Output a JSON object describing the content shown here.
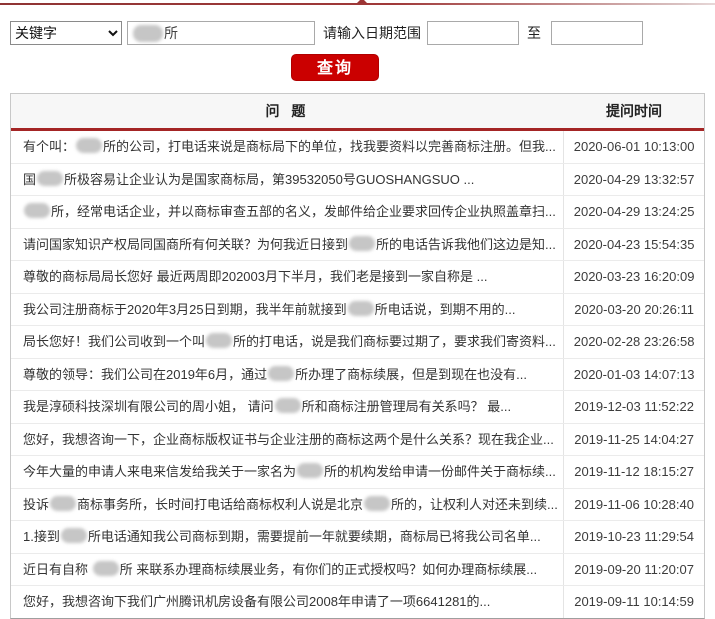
{
  "colors": {
    "accent_red": "#cb0000",
    "header_rule_red": "#a42525",
    "top_line_red": "#9c3535"
  },
  "search_form": {
    "field_type_select": {
      "value": "关键字"
    },
    "keyword_input": {
      "visible_text": "所",
      "censored_prefix": "██"
    },
    "date_range_label": "请输入日期范围",
    "date_from_value": "",
    "date_to_value": "",
    "to_label": "至",
    "search_button": "查询"
  },
  "table": {
    "headers": {
      "question": "问 题",
      "time": "提问时间"
    },
    "rows": [
      {
        "segments": [
          {
            "censored": false,
            "text": "有个叫："
          },
          {
            "censored": true,
            "text": "██"
          },
          {
            "censored": false,
            "text": "所的公司，打电话来说是商标局下的单位，找我要资料以完善商标注册。但我..."
          }
        ],
        "time": "2020-06-01 10:13:00"
      },
      {
        "segments": [
          {
            "censored": false,
            "text": "国"
          },
          {
            "censored": true,
            "text": "██"
          },
          {
            "censored": false,
            "text": "所极容易让企业认为是国家商标局，第39532050号GUOSHANGSUO ..."
          }
        ],
        "time": "2020-04-29 13:32:57"
      },
      {
        "segments": [
          {
            "censored": true,
            "text": "██"
          },
          {
            "censored": false,
            "text": "所，经常电话企业，并以商标审查五部的名义，发邮件给企业要求回传企业执照盖章扫..."
          }
        ],
        "time": "2020-04-29 13:24:25"
      },
      {
        "segments": [
          {
            "censored": false,
            "text": "请问国家知识产权局同国商所有何关联？为何我近日接到"
          },
          {
            "censored": true,
            "text": "██"
          },
          {
            "censored": false,
            "text": "所的电话告诉我他们这边是知..."
          }
        ],
        "time": "2020-04-23 15:54:35"
      },
      {
        "segments": [
          {
            "censored": false,
            "text": "尊敬的商标局局长您好 最近两周即202003月下半月，我们老是接到一家自称是 ..."
          }
        ],
        "time": "2020-03-23 16:20:09"
      },
      {
        "segments": [
          {
            "censored": false,
            "text": "我公司注册商标于2020年3月25日到期，我半年前就接到"
          },
          {
            "censored": true,
            "text": "██"
          },
          {
            "censored": false,
            "text": "所电话说，到期不用的..."
          }
        ],
        "time": "2020-03-20 20:26:11"
      },
      {
        "segments": [
          {
            "censored": false,
            "text": "局长您好！我们公司收到一个叫"
          },
          {
            "censored": true,
            "text": "██"
          },
          {
            "censored": false,
            "text": "所的打电话，说是我们商标要过期了，要求我们寄资料..."
          }
        ],
        "time": "2020-02-28 23:26:58"
      },
      {
        "segments": [
          {
            "censored": false,
            "text": "尊敬的领导：我们公司在2019年6月，通过"
          },
          {
            "censored": true,
            "text": "██"
          },
          {
            "censored": false,
            "text": "所办理了商标续展，但是到现在也没有..."
          }
        ],
        "time": "2020-01-03 14:07:13"
      },
      {
        "segments": [
          {
            "censored": false,
            "text": "我是淳硕科技深圳有限公司的周小姐， 请问"
          },
          {
            "censored": true,
            "text": "██"
          },
          {
            "censored": false,
            "text": "所和商标注册管理局有关系吗？ 最..."
          }
        ],
        "time": "2019-12-03 11:52:22"
      },
      {
        "segments": [
          {
            "censored": false,
            "text": "您好，我想咨询一下，企业商标版权证书与企业注册的商标这两个是什么关系？现在我企业..."
          }
        ],
        "time": "2019-11-25 14:04:27"
      },
      {
        "segments": [
          {
            "censored": false,
            "text": "今年大量的申请人来电来信发给我关于一家名为"
          },
          {
            "censored": true,
            "text": "██"
          },
          {
            "censored": false,
            "text": "所的机构发给申请一份邮件关于商标续..."
          }
        ],
        "time": "2019-11-12 18:15:27"
      },
      {
        "segments": [
          {
            "censored": false,
            "text": "投诉"
          },
          {
            "censored": true,
            "text": "██"
          },
          {
            "censored": false,
            "text": "商标事务所，长时间打电话给商标权利人说是北京"
          },
          {
            "censored": true,
            "text": "██"
          },
          {
            "censored": false,
            "text": "所的，让权利人对还未到续..."
          }
        ],
        "time": "2019-11-06 10:28:40"
      },
      {
        "segments": [
          {
            "censored": false,
            "text": "1.接到"
          },
          {
            "censored": true,
            "text": "██"
          },
          {
            "censored": false,
            "text": "所电话通知我公司商标到期，需要提前一年就要续期，商标局已将我公司名单..."
          }
        ],
        "time": "2019-10-23 11:29:54"
      },
      {
        "segments": [
          {
            "censored": false,
            "text": "近日有自称 "
          },
          {
            "censored": true,
            "text": "██"
          },
          {
            "censored": false,
            "text": "所 来联系办理商标续展业务，有你们的正式授权吗？如何办理商标续展..."
          }
        ],
        "time": "2019-09-20 11:20:07"
      },
      {
        "segments": [
          {
            "censored": false,
            "text": "您好，我想咨询下我们广州腾讯机房设备有限公司2008年申请了一项6641281的..."
          }
        ],
        "time": "2019-09-11 10:14:59"
      }
    ]
  }
}
